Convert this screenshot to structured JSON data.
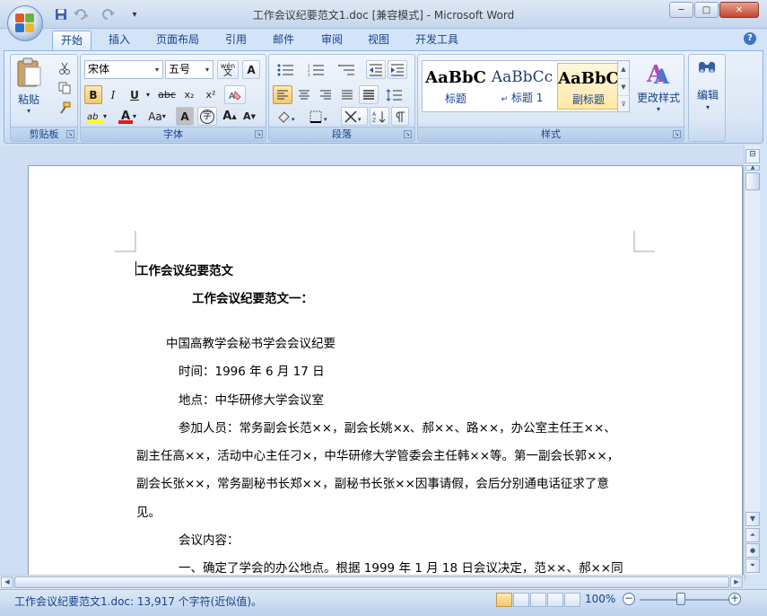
{
  "window": {
    "title": "工作会议纪要范文1.doc [兼容模式] - Microsoft Word",
    "minimize": "─",
    "maximize": "□",
    "close": "✕"
  },
  "quick_access": {
    "save_icon": "save-icon",
    "undo_icon": "undo-icon",
    "redo_icon": "redo-icon",
    "customize": "▾"
  },
  "tabs": [
    "开始",
    "插入",
    "页面布局",
    "引用",
    "邮件",
    "审阅",
    "视图",
    "开发工具"
  ],
  "active_tab": "开始",
  "ribbon": {
    "clipboard": {
      "label": "剪贴板",
      "paste": "粘贴",
      "paste_arrow": "▾"
    },
    "font": {
      "label": "字体",
      "font_name": "宋体",
      "font_size": "五号",
      "bold": "B",
      "italic": "I",
      "underline": "U",
      "strike": "abc",
      "subscript": "x₂",
      "superscript": "x²",
      "font_color": "A",
      "case": "Aa",
      "grow": "A",
      "shrink": "A",
      "highlight": "ab",
      "char_border": "A",
      "phonetic": "wén",
      "enclose": "字"
    },
    "paragraph": {
      "label": "段落"
    },
    "styles": {
      "label": "样式",
      "items": [
        {
          "sample": "AaBbC",
          "name": "标题"
        },
        {
          "sample": "AaBbCc",
          "name": "标题 1"
        },
        {
          "sample": "AaBbC",
          "name": "副标题"
        }
      ],
      "change_styles": "更改样式"
    },
    "editing": {
      "label": "编辑"
    }
  },
  "document": {
    "lines": [
      {
        "text": "工作会议纪要范文",
        "bold": true
      },
      {
        "text": "工作会议纪要范文一：",
        "bold": true
      },
      {
        "text": "中国高教学会秘书学会会议纪要",
        "bold": false
      },
      {
        "text": "时间：1996 年 6 月 17 日",
        "bold": false
      },
      {
        "text": "地点：中华研修大学会议室",
        "bold": false
      },
      {
        "text": "参加人员：常务副会长范××，副会长姚×x、郝××、路××，办公室主任王××、",
        "bold": false
      },
      {
        "text": "副主任高××，活动中心主任刁×，中华研修大学管委会主任韩××等。第一副会长郭××，",
        "bold": false
      },
      {
        "text": "副会长张××，常务副秘书长郑××，副秘书长张××因事请假，会后分别通电话征求了意",
        "bold": false
      },
      {
        "text": "见。",
        "bold": false
      },
      {
        "text": "会议内容：",
        "bold": false
      },
      {
        "text": "一、确定了学会的办公地点。根据 1999 年 1 月 18 日会议决定，范××、郝××同",
        "bold": false
      }
    ]
  },
  "statusbar": {
    "text": "工作会议纪要范文1.doc: 13,917 个字符(近似值)。",
    "zoom": "100%",
    "zoom_out": "−",
    "zoom_in": "+"
  }
}
